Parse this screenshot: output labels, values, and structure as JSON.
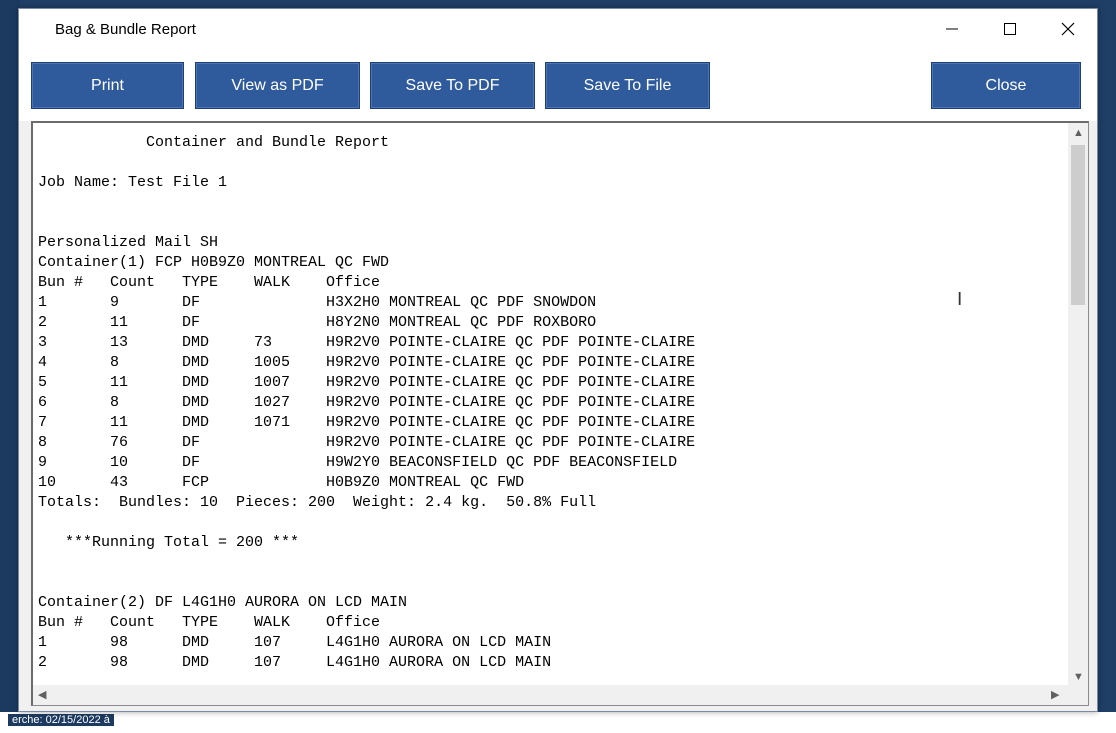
{
  "background": {
    "status_text": "erche: 02/15/2022 à"
  },
  "window": {
    "title": "Bag & Bundle Report",
    "minimize_icon": "minimize-icon",
    "maximize_icon": "maximize-icon",
    "close_icon": "close-icon"
  },
  "toolbar": {
    "print_label": "Print",
    "view_pdf_label": "View as PDF",
    "save_pdf_label": "Save To PDF",
    "save_file_label": "Save To File",
    "close_label": "Close"
  },
  "colors": {
    "button_bg": "#2f5b9c",
    "button_text": "#ffffff",
    "app_bg": "#1f3f66"
  },
  "report": {
    "lines": [
      "            Container and Bundle Report",
      "",
      "Job Name: Test File 1",
      "",
      "",
      "Personalized Mail SH",
      "Container(1) FCP H0B9Z0 MONTREAL QC FWD",
      "Bun #   Count   TYPE    WALK    Office",
      "1       9       DF              H3X2H0 MONTREAL QC PDF SNOWDON",
      "2       11      DF              H8Y2N0 MONTREAL QC PDF ROXBORO",
      "3       13      DMD     73      H9R2V0 POINTE-CLAIRE QC PDF POINTE-CLAIRE",
      "4       8       DMD     1005    H9R2V0 POINTE-CLAIRE QC PDF POINTE-CLAIRE",
      "5       11      DMD     1007    H9R2V0 POINTE-CLAIRE QC PDF POINTE-CLAIRE",
      "6       8       DMD     1027    H9R2V0 POINTE-CLAIRE QC PDF POINTE-CLAIRE",
      "7       11      DMD     1071    H9R2V0 POINTE-CLAIRE QC PDF POINTE-CLAIRE",
      "8       76      DF              H9R2V0 POINTE-CLAIRE QC PDF POINTE-CLAIRE",
      "9       10      DF              H9W2Y0 BEACONSFIELD QC PDF BEACONSFIELD",
      "10      43      FCP             H0B9Z0 MONTREAL QC FWD",
      "Totals:  Bundles: 10  Pieces: 200  Weight: 2.4 kg.  50.8% Full",
      "",
      "   ***Running Total = 200 ***",
      "",
      "",
      "Container(2) DF L4G1H0 AURORA ON LCD MAIN",
      "Bun #   Count   TYPE    WALK    Office",
      "1       98      DMD     107     L4G1H0 AURORA ON LCD MAIN",
      "2       98      DMD     107     L4G1H0 AURORA ON LCD MAIN"
    ]
  }
}
